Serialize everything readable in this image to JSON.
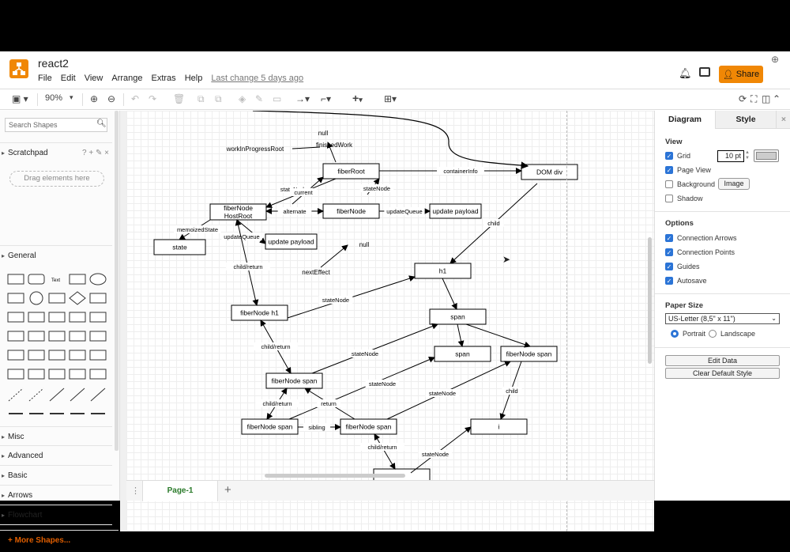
{
  "app": {
    "title": "react2",
    "menu": [
      "File",
      "Edit",
      "View",
      "Arrange",
      "Extras",
      "Help"
    ],
    "last_change": "Last change 5 days ago",
    "share": "Share",
    "accent": "#f08705"
  },
  "toolbar": {
    "zoom": "90%"
  },
  "sidebar": {
    "search_placeholder": "Search Shapes",
    "scratchpad": "Scratchpad",
    "scratch_icons": "? + ✎ ×",
    "drag": "Drag elements here",
    "general": "General",
    "sections": [
      "Misc",
      "Advanced",
      "Basic",
      "Arrows",
      "Flowchart"
    ],
    "more": "+ More Shapes...",
    "shape_text": "Text"
  },
  "pages": {
    "tab": "Page-1",
    "add": "+"
  },
  "panel": {
    "tabs": [
      "Diagram",
      "Style"
    ],
    "view": "View",
    "grid": "Grid",
    "grid_size": "10 pt",
    "page_view": "Page View",
    "background": "Background",
    "image": "Image",
    "shadow": "Shadow",
    "options": "Options",
    "opts": [
      "Connection Arrows",
      "Connection Points",
      "Guides",
      "Autosave"
    ],
    "paper": "Paper Size",
    "paper_value": "US-Letter (8,5\" x 11\")",
    "portrait": "Portrait",
    "landscape": "Landscape",
    "edit_data": "Edit Data",
    "clear_style": "Clear Default Style",
    "checked": {
      "grid": true,
      "page_view": true,
      "background": false,
      "shadow": false,
      "opts": [
        true,
        true,
        true,
        true
      ]
    },
    "orientation": "Portrait"
  },
  "diagram": {
    "nodes": [
      "fiberRoot",
      "DOM div",
      "fiberNode\nHostRoot",
      "fiberNode",
      "update payload",
      "state",
      "update payload",
      "h1",
      "fiberNode  h1",
      "span",
      "span",
      "fiberNode  span",
      "fiberNode  span",
      "fiberNode  span",
      "fiberNode  span",
      "i",
      ""
    ],
    "texts": [
      "null",
      "workInProgressRoot",
      "finishedWork",
      "null",
      "nextEffect"
    ],
    "edge_labels": [
      "containerInfo",
      "stateNode",
      "current",
      "stateNode",
      "alternate",
      "updateQueue",
      "memoizedState",
      "updateQueue",
      "child/return",
      "child",
      "stateNode",
      "",
      "child/return",
      "stateNode",
      "stateNode",
      "",
      "",
      "child/return",
      "return",
      "sibling",
      "stateNode",
      "child",
      "child/return",
      "stateNode",
      ""
    ]
  }
}
